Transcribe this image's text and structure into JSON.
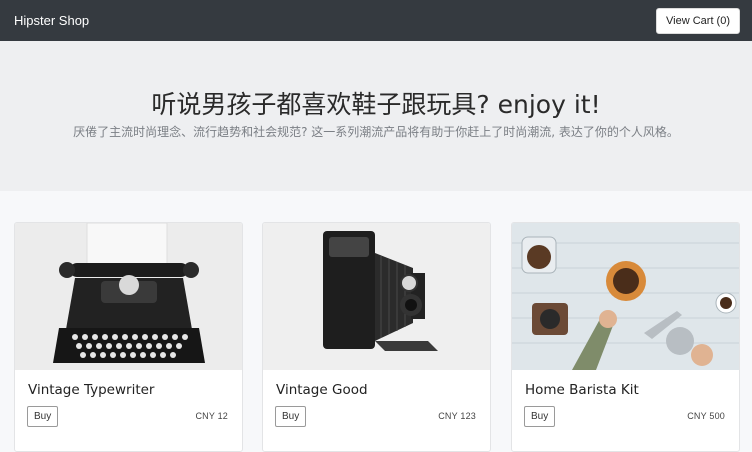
{
  "navbar": {
    "brand": "Hipster Shop",
    "cart_label": "View Cart (0)"
  },
  "hero": {
    "title": "听说男孩子都喜欢鞋子跟玩具? enjoy it!",
    "subtitle": "厌倦了主流时尚理念、流行趋势和社会规范? 这一系列潮流产品将有助于你赶上了时尚潮流, 表达了你的个人风格。"
  },
  "products": [
    {
      "name": "Vintage Typewriter",
      "buy_label": "Buy",
      "price": "CNY 12",
      "image_icon": "typewriter-photo"
    },
    {
      "name": "Vintage Good",
      "buy_label": "Buy",
      "price": "CNY 123",
      "image_icon": "camera-photo"
    },
    {
      "name": "Home Barista Kit",
      "buy_label": "Buy",
      "price": "CNY 500",
      "image_icon": "coffee-kit-photo"
    }
  ],
  "colors": {
    "navbar_bg": "#353a40",
    "hero_bg": "#eeeff1",
    "page_bg": "#f7f8fa"
  }
}
